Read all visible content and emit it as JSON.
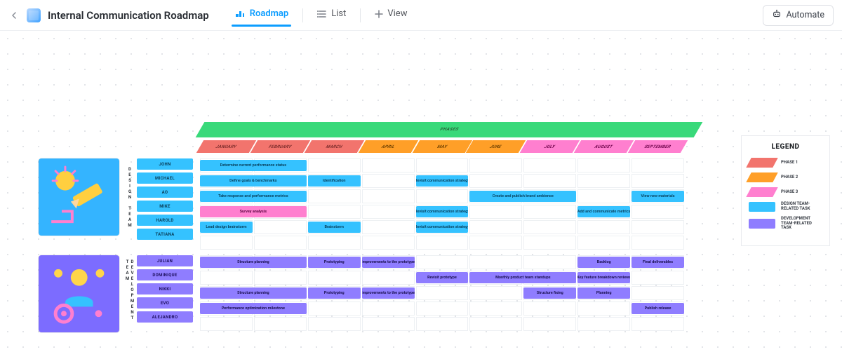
{
  "header": {
    "title": "Internal Communication Roadmap",
    "tabs": [
      {
        "label": "Roadmap",
        "icon": "roadmap-icon",
        "active": true
      },
      {
        "label": "List",
        "icon": "list-icon",
        "active": false
      }
    ],
    "add_view_label": "View",
    "automate_label": "Automate"
  },
  "colors": {
    "phase1": "#f2746d",
    "phase2": "#ff9f28",
    "phase3": "#ff7fcf",
    "phases_strip": "#39d97a",
    "design_task": "#35c2ff",
    "dev_task": "#8f7dff"
  },
  "roadmap": {
    "phases_label": "PHASES",
    "months": [
      "JANUARY",
      "FEBRUARY",
      "MARCH",
      "APRIL",
      "MAY",
      "JUNE",
      "JULY",
      "AUGUST",
      "SEPTEMBER"
    ],
    "month_phase": [
      1,
      1,
      1,
      2,
      2,
      2,
      3,
      3,
      3
    ],
    "teams": {
      "design": {
        "label": "DESIGN TEAM",
        "people": [
          "JOHN",
          "MICHAEL",
          "AO",
          "MIKE",
          "HAROLD",
          "TATIANA"
        ],
        "bars": [
          {
            "row": 0,
            "start": 0,
            "span": 2,
            "cls": "blue",
            "text": "Determine current performance status"
          },
          {
            "row": 1,
            "start": 0,
            "span": 2,
            "cls": "blue",
            "text": "Define goals & benchmarks"
          },
          {
            "row": 1,
            "start": 2,
            "span": 1,
            "cls": "blue",
            "text": "Identification"
          },
          {
            "row": 1,
            "start": 4,
            "span": 1,
            "cls": "blue",
            "text": "Revisit communication strategy"
          },
          {
            "row": 2,
            "start": 0,
            "span": 2,
            "cls": "blue",
            "text": "Take response and performance metrics"
          },
          {
            "row": 2,
            "start": 5,
            "span": 2,
            "cls": "blue",
            "text": "Create and publish brand ambience"
          },
          {
            "row": 2,
            "start": 8,
            "span": 1,
            "cls": "blue",
            "text": "View new materials"
          },
          {
            "row": 3,
            "start": 0,
            "span": 2,
            "cls": "pink",
            "text": "Survey analysis"
          },
          {
            "row": 3,
            "start": 4,
            "span": 1,
            "cls": "blue",
            "text": "Revisit communication strategy"
          },
          {
            "row": 3,
            "start": 7,
            "span": 1,
            "cls": "blue",
            "text": "Add and communicate metrics"
          },
          {
            "row": 4,
            "start": 0,
            "span": 1,
            "cls": "blue",
            "text": "Lead design brainstorm"
          },
          {
            "row": 4,
            "start": 2,
            "span": 1,
            "cls": "blue",
            "text": "Brainstorm"
          },
          {
            "row": 4,
            "start": 4,
            "span": 1,
            "cls": "blue",
            "text": "Revisit communication strategy"
          }
        ]
      },
      "development": {
        "label": "DEVELOPMENT TEAM",
        "people": [
          "JULIAN",
          "DOMINIQUE",
          "NIKKI",
          "EVO",
          "ALEJANDRO"
        ],
        "bars": [
          {
            "row": 0,
            "start": 0,
            "span": 2,
            "cls": "purple",
            "text": "Structure planning"
          },
          {
            "row": 0,
            "start": 2,
            "span": 1,
            "cls": "purple",
            "text": "Prototyping"
          },
          {
            "row": 0,
            "start": 3,
            "span": 1,
            "cls": "purple",
            "text": "Improvements to the prototype"
          },
          {
            "row": 0,
            "start": 7,
            "span": 1,
            "cls": "purple",
            "text": "Backlog"
          },
          {
            "row": 0,
            "start": 8,
            "span": 1,
            "cls": "purple",
            "text": "Final deliverables"
          },
          {
            "row": 1,
            "start": 4,
            "span": 1,
            "cls": "purple",
            "text": "Revisit prototype"
          },
          {
            "row": 1,
            "start": 5,
            "span": 2,
            "cls": "purple",
            "text": "Monthly product team standups"
          },
          {
            "row": 1,
            "start": 7,
            "span": 1,
            "cls": "purple",
            "text": "Key feature breakdown reviews"
          },
          {
            "row": 2,
            "start": 0,
            "span": 2,
            "cls": "purple",
            "text": "Structure planning"
          },
          {
            "row": 2,
            "start": 2,
            "span": 1,
            "cls": "purple",
            "text": "Prototyping"
          },
          {
            "row": 2,
            "start": 3,
            "span": 1,
            "cls": "purple",
            "text": "Improvements to the prototype"
          },
          {
            "row": 2,
            "start": 6,
            "span": 1,
            "cls": "purple",
            "text": "Structure fixing"
          },
          {
            "row": 2,
            "start": 7,
            "span": 1,
            "cls": "purple",
            "text": "Planning"
          },
          {
            "row": 3,
            "start": 0,
            "span": 2,
            "cls": "purple",
            "text": "Performance optimization milestone"
          },
          {
            "row": 3,
            "start": 8,
            "span": 1,
            "cls": "purple",
            "text": "Publish release"
          }
        ]
      }
    }
  },
  "legend": {
    "title": "LEGEND",
    "items": [
      {
        "color": "#f2746d",
        "shape": "skew",
        "label": "PHASE 1"
      },
      {
        "color": "#ff9f28",
        "shape": "skew",
        "label": "PHASE 2"
      },
      {
        "color": "#ff7fcf",
        "shape": "skew",
        "label": "PHASE 3"
      },
      {
        "color": "#35c2ff",
        "shape": "square",
        "label": "DESIGN TEAM-RELATED TASK"
      },
      {
        "color": "#8f7dff",
        "shape": "square",
        "label": "DEVELOPMENT TEAM-RELATED TASK"
      }
    ]
  }
}
